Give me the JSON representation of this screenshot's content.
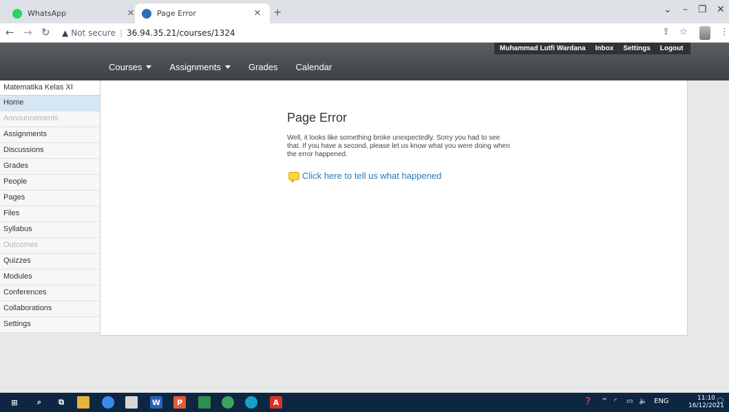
{
  "browser": {
    "tabs": [
      {
        "title": "WhatsApp",
        "icon": "whatsapp-icon"
      },
      {
        "title": "Page Error",
        "icon": "canvas-icon"
      }
    ],
    "address": {
      "security": "Not secure",
      "url": "36.94.35.21/courses/1324"
    }
  },
  "header": {
    "user": {
      "name": "Muhammad Lutfi Wardana",
      "inbox": "Inbox",
      "settings": "Settings",
      "logout": "Logout"
    },
    "nav": {
      "courses": "Courses",
      "assignments": "Assignments",
      "grades": "Grades",
      "calendar": "Calendar"
    }
  },
  "sidebar": {
    "course_title": "Matematika Kelas XI",
    "items": [
      {
        "label": "Home"
      },
      {
        "label": "Announcements"
      },
      {
        "label": "Assignments"
      },
      {
        "label": "Discussions"
      },
      {
        "label": "Grades"
      },
      {
        "label": "People"
      },
      {
        "label": "Pages"
      },
      {
        "label": "Files"
      },
      {
        "label": "Syllabus"
      },
      {
        "label": "Outcomes"
      },
      {
        "label": "Quizzes"
      },
      {
        "label": "Modules"
      },
      {
        "label": "Conferences"
      },
      {
        "label": "Collaborations"
      },
      {
        "label": "Settings"
      }
    ]
  },
  "error": {
    "title": "Page Error",
    "message": "Well, it looks like something broke unexpectedly. Sorry you had to see that. If you have a second, please let us know what you were doing when the error happened.",
    "link": "Click here to tell us what happened"
  },
  "taskbar": {
    "language": "ENG",
    "time": "11:10",
    "date": "16/12/2021"
  },
  "colors": {
    "header": "#45494d",
    "link": "#2a7ab3",
    "active_sidebar": "#d6e7f3",
    "taskbar": "#0d2742"
  }
}
